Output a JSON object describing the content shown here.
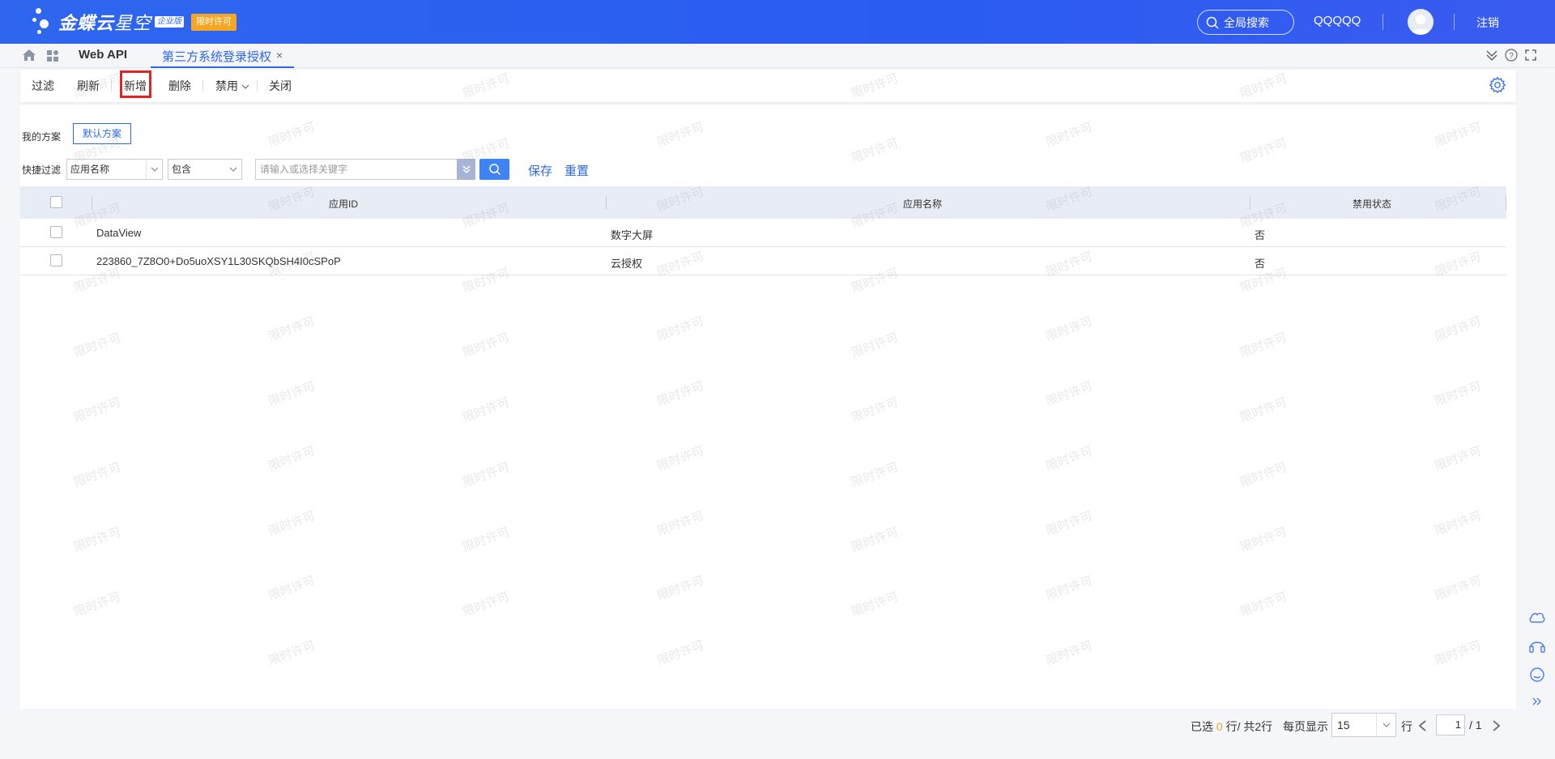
{
  "header": {
    "logo_text_bold": "金蝶云",
    "logo_text_thin": "星空",
    "edition": "企业版",
    "trial_badge": "限时许可",
    "global_search": "全局搜索",
    "username": "QQQQQ",
    "logout": "注销"
  },
  "tabs": {
    "webapi": "Web API",
    "active": "第三方系统登录授权",
    "close": "×"
  },
  "toolbar": {
    "filter": "过滤",
    "refresh": "刷新",
    "add": "新增",
    "delete": "删除",
    "disable": "禁用",
    "close": "关闭"
  },
  "scheme": {
    "label": "我的方案",
    "default": "默认方案"
  },
  "quick_filter": {
    "label": "快捷过滤",
    "field": "应用名称",
    "operator": "包含",
    "keyword_placeholder": "请输入或选择关键字",
    "save": "保存",
    "reset": "重置"
  },
  "grid": {
    "columns": [
      "应用ID",
      "应用名称",
      "禁用状态"
    ],
    "rows": [
      {
        "app_id": "DataView",
        "app_name": "数字大屏",
        "disabled": "否"
      },
      {
        "app_id": "223860_7Z8O0+Do5uoXSY1L30SKQbSH4I0cSPoP",
        "app_name": "云授权",
        "disabled": "否"
      }
    ]
  },
  "pager": {
    "selected_prefix": "已选",
    "selected_count": "0",
    "selected_suffix": "行/ 共2行",
    "per_page_label": "每页显示",
    "page_size": "15",
    "row_unit": "行",
    "current_page": "1",
    "total_pages": "/ 1"
  },
  "watermark": "限时许可",
  "colors": {
    "brand": "#2e66f0",
    "highlight": "#e32222",
    "badge": "#f5a623"
  }
}
